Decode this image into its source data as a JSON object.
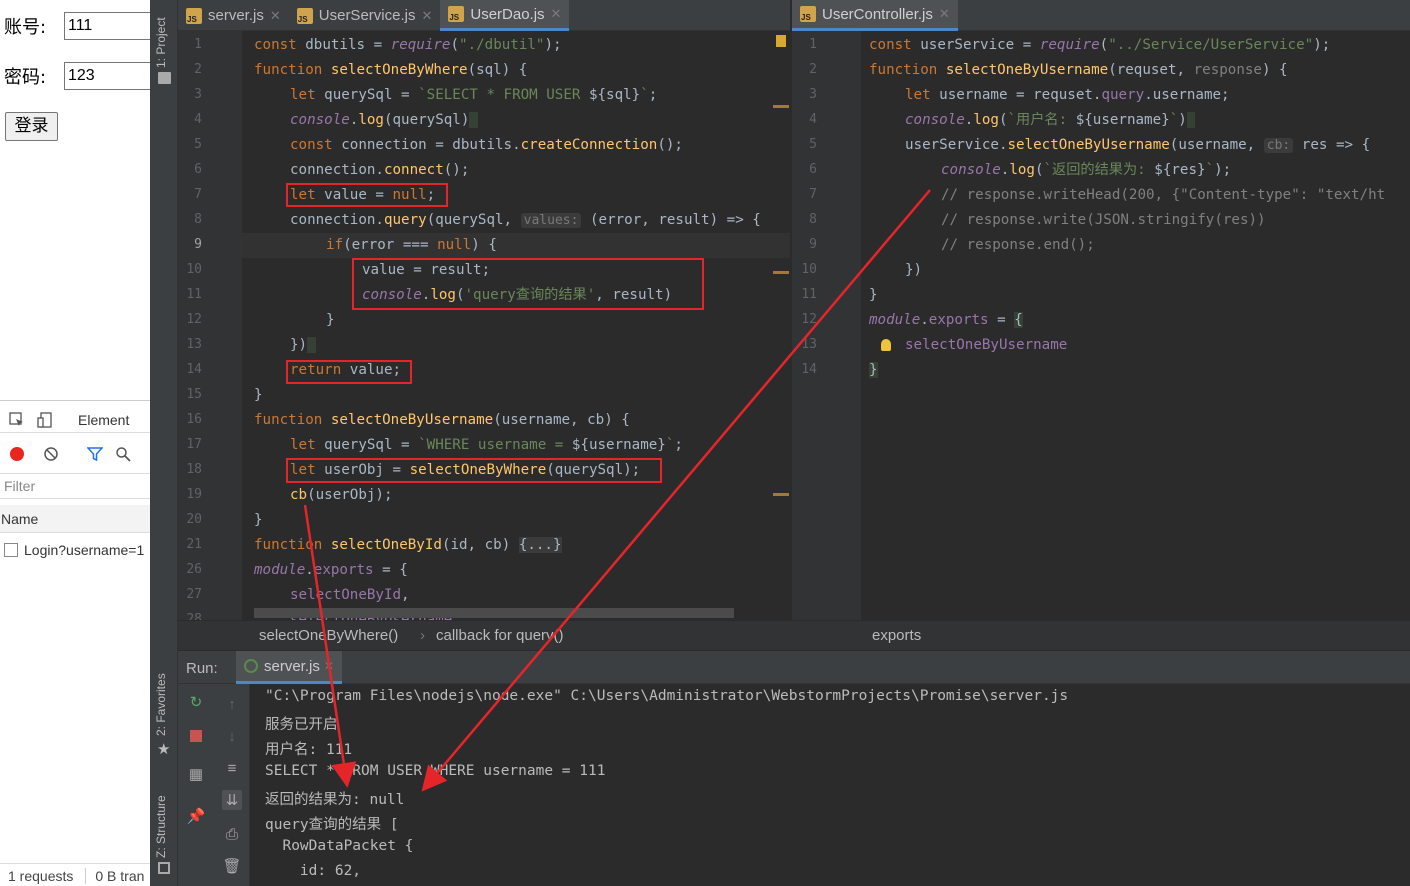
{
  "browser": {
    "account_label": "账号:",
    "account_value": "111",
    "password_label": "密码:",
    "password_value": "123",
    "login_button": "登录"
  },
  "devtools": {
    "elements_tab": "Element",
    "filter_placeholder": "Filter",
    "name_header": "Name",
    "request_item": "Login?username=1",
    "status_requests": "1 requests",
    "status_transferred": "0 B tran"
  },
  "tool_strip": {
    "project": "1: Project",
    "favorites": "2: Favorites",
    "structure": "Z: Structure"
  },
  "tabs_left": [
    {
      "label": "server.js",
      "active": false
    },
    {
      "label": "UserService.js",
      "active": false
    },
    {
      "label": "UserDao.js",
      "active": true
    }
  ],
  "tabs_right": [
    {
      "label": "UserController.js",
      "active": true
    }
  ],
  "editor_left": {
    "line_numbers": [
      "1",
      "2",
      "3",
      "4",
      "5",
      "6",
      "7",
      "8",
      "9",
      "10",
      "11",
      "12",
      "13",
      "14",
      "15",
      "16",
      "17",
      "18",
      "19",
      "20",
      "21",
      "26",
      "27",
      "28"
    ],
    "current_line": "9"
  },
  "editor_right": {
    "line_numbers": [
      "1",
      "2",
      "3",
      "4",
      "5",
      "6",
      "7",
      "8",
      "9",
      "10",
      "11",
      "12",
      "13",
      "14"
    ]
  },
  "breadcrumb": {
    "item1": "selectOneByWhere()",
    "item2": "callback for query()",
    "item3": "exports"
  },
  "run": {
    "label": "Run:",
    "tab": "server.js",
    "console_lines": [
      "\"C:\\Program Files\\nodejs\\node.exe\" C:\\Users\\Administrator\\WebstormProjects\\Promise\\server.js",
      "服务已开启",
      "用户名: 111",
      "SELECT * FROM USER WHERE username = 111",
      "返回的结果为: null",
      "query查询的结果 [",
      "  RowDataPacket {",
      "    id: 62,"
    ]
  },
  "colors": {
    "annotation_red": "#e5252a",
    "editor_bg": "#2b2b2b",
    "keyword": "#cc7832",
    "function": "#ffc66d",
    "string": "#6a8759"
  }
}
